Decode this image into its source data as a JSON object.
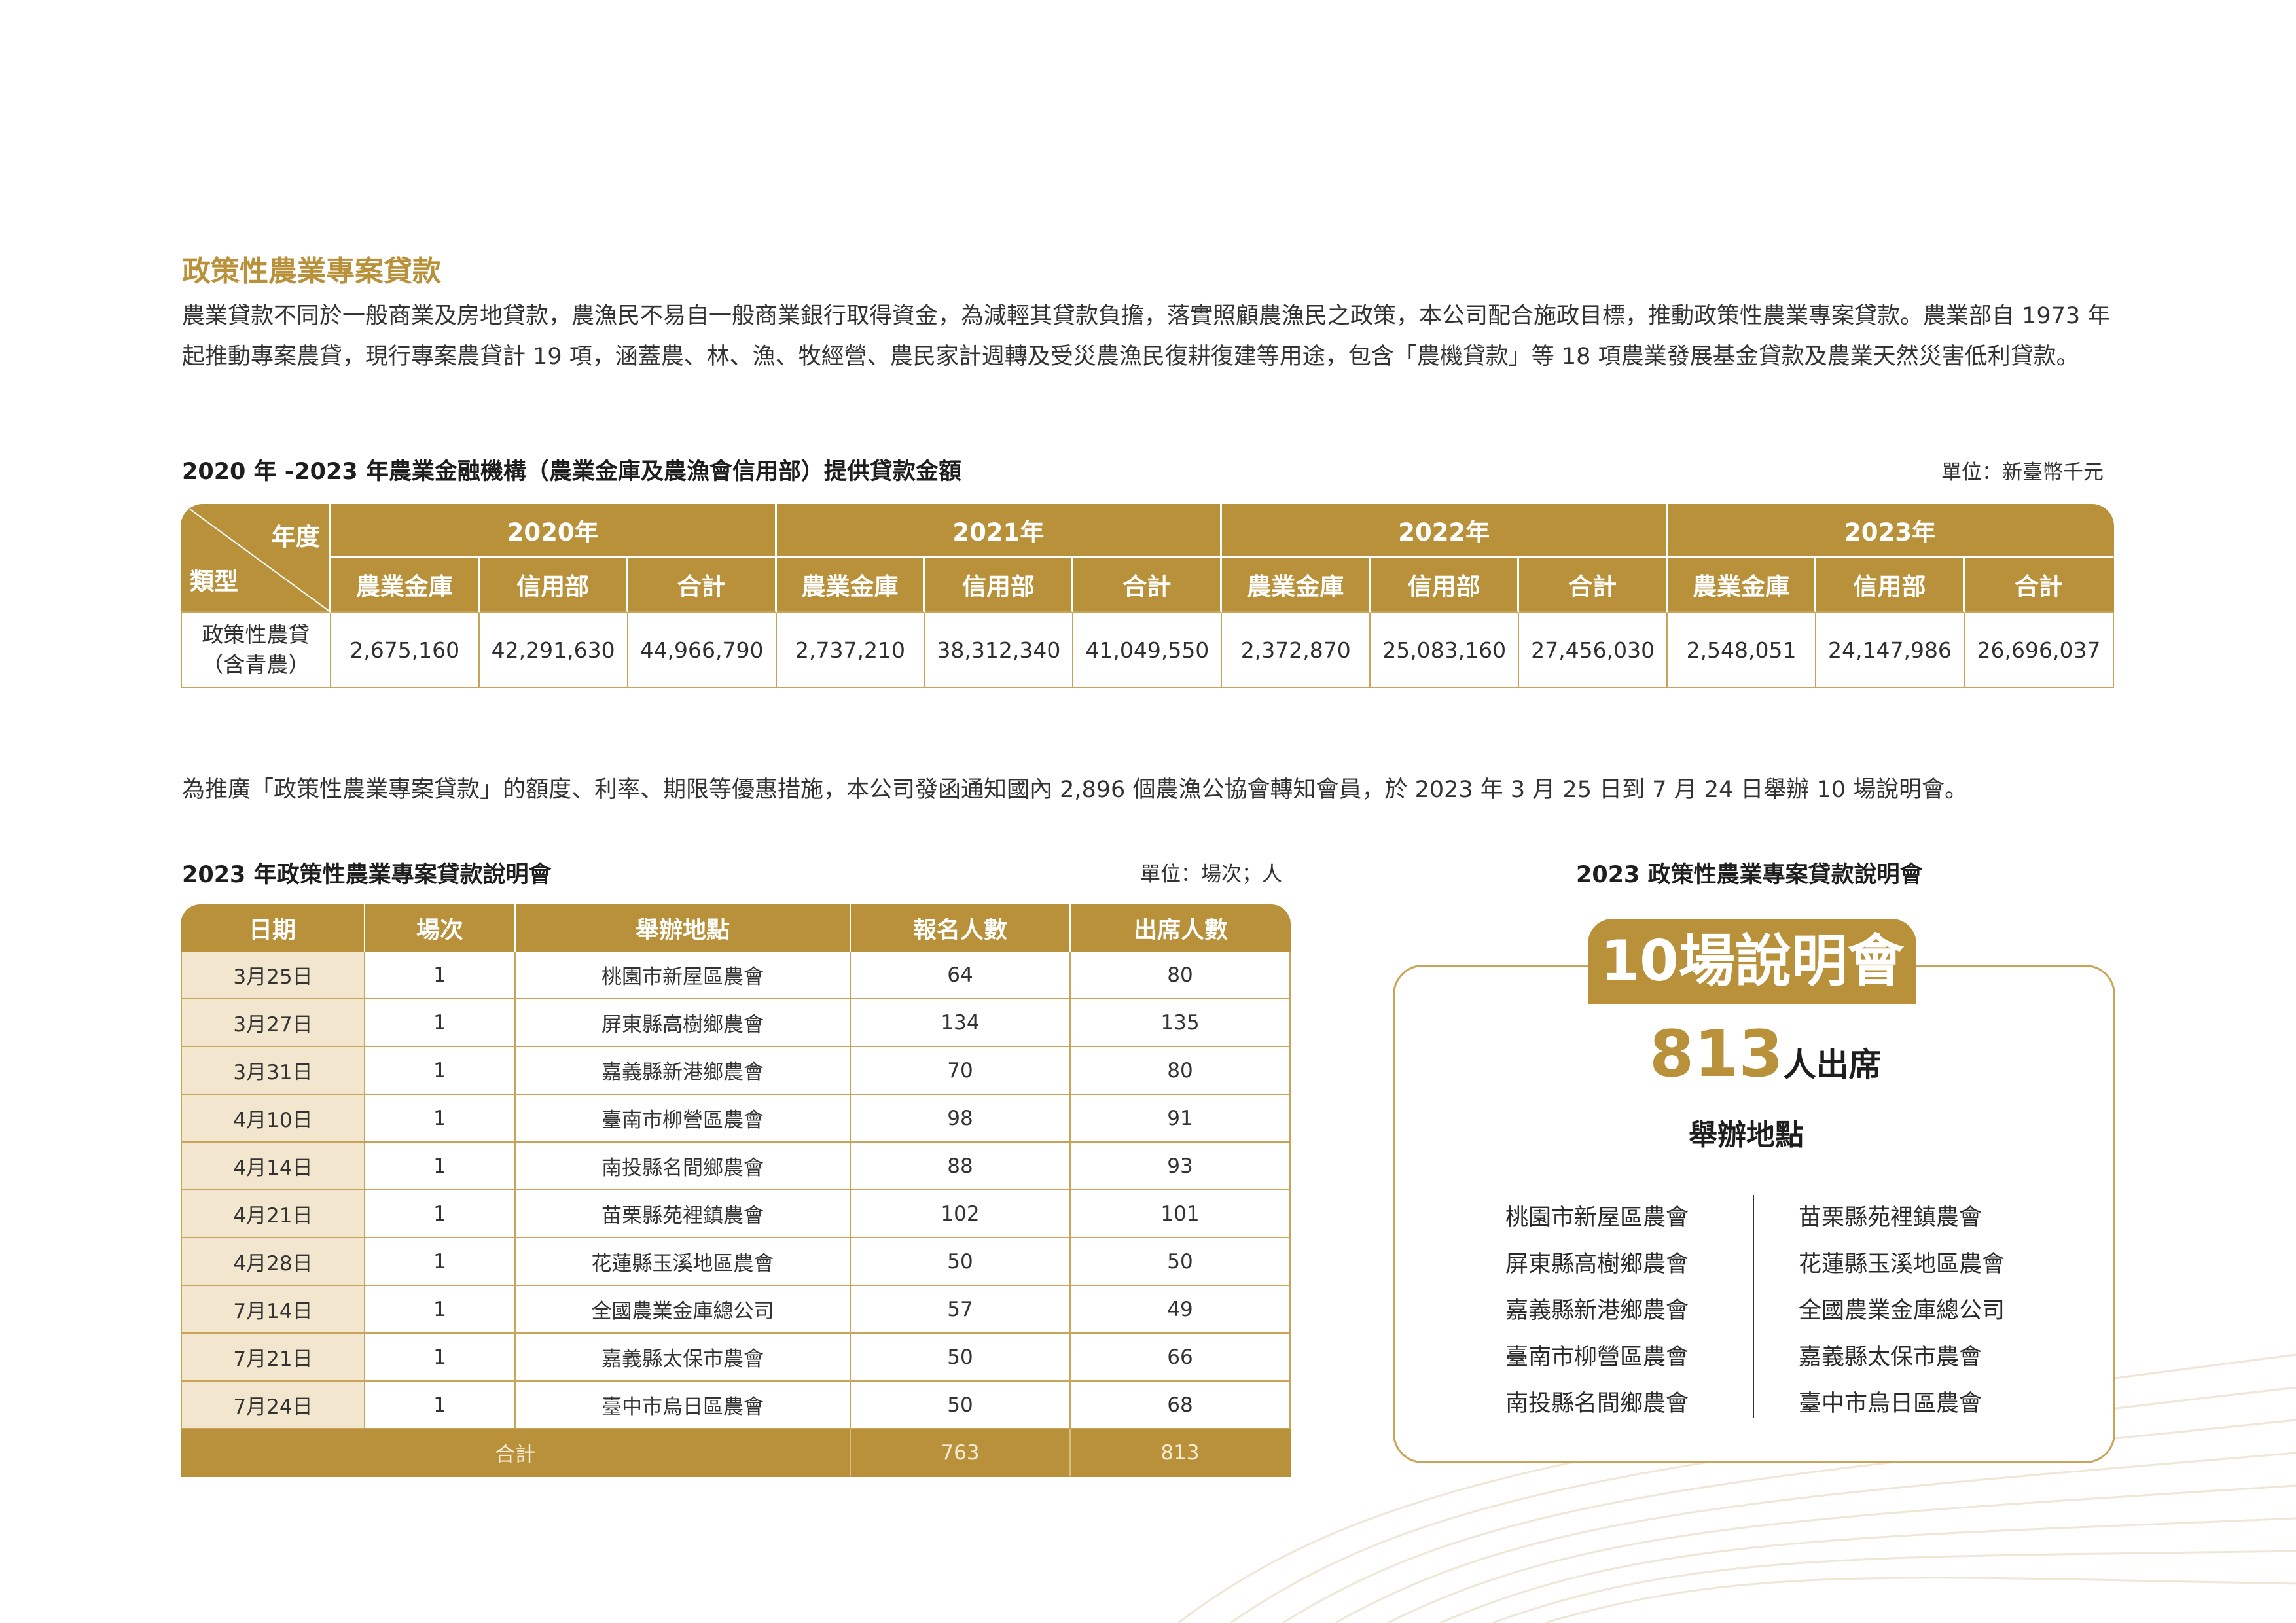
{
  "section_title": "政策性農業專案貸款",
  "intro_paragraph": "農業貸款不同於一般商業及房地貸款，農漁民不易自一般商業銀行取得資金，為減輕其貸款負擔，落實照顧農漁民之政策，本公司配合施政目標，推動政策性農業專案貸款。農業部自 1973 年起推動專案農貸，現行專案農貸計 19 項，涵蓋農、林、漁、牧經營、農民家計週轉及受災農漁民復耕復建等用途，包含「農機貸款」等 18 項農業發展基金貸款及農業天然災害低利貸款。",
  "loan_table": {
    "title": "2020 年 -2023 年農業金融機構（農業金庫及農漁會信用部）提供貸款金額",
    "unit": "單位：新臺幣千元",
    "corner_top": "年度",
    "corner_bottom": "類型",
    "years": [
      "2020年",
      "2021年",
      "2022年",
      "2023年"
    ],
    "sub_headers": [
      "農業金庫",
      "信用部",
      "合計"
    ],
    "row_label_line1": "政策性農貸",
    "row_label_line2": "（含青農）",
    "values": [
      "2,675,160",
      "42,291,630",
      "44,966,790",
      "2,737,210",
      "38,312,340",
      "41,049,550",
      "2,372,870",
      "25,083,160",
      "27,456,030",
      "2,548,051",
      "24,147,986",
      "26,696,037"
    ]
  },
  "promo_paragraph": "為推廣「政策性農業專案貸款」的額度、利率、期限等優惠措施，本公司發函通知國內 2,896 個農漁公協會轉知會員，於 2023 年 3 月 25 日到 7 月 24 日舉辦 10 場說明會。",
  "seminar_table": {
    "title": "2023 年政策性農業專案貸款說明會",
    "unit": "單位：場次；人",
    "headers": [
      "日期",
      "場次",
      "舉辦地點",
      "報名人數",
      "出席人數"
    ],
    "rows": [
      [
        "3月25日",
        "1",
        "桃園市新屋區農會",
        "64",
        "80"
      ],
      [
        "3月27日",
        "1",
        "屏東縣高樹鄉農會",
        "134",
        "135"
      ],
      [
        "3月31日",
        "1",
        "嘉義縣新港鄉農會",
        "70",
        "80"
      ],
      [
        "4月10日",
        "1",
        "臺南市柳營區農會",
        "98",
        "91"
      ],
      [
        "4月14日",
        "1",
        "南投縣名間鄉農會",
        "88",
        "93"
      ],
      [
        "4月21日",
        "1",
        "苗栗縣苑裡鎮農會",
        "102",
        "101"
      ],
      [
        "4月28日",
        "1",
        "花蓮縣玉溪地區農會",
        "50",
        "50"
      ],
      [
        "7月14日",
        "1",
        "全國農業金庫總公司",
        "57",
        "49"
      ],
      [
        "7月21日",
        "1",
        "嘉義縣太保市農會",
        "50",
        "66"
      ],
      [
        "7月24日",
        "1",
        "臺中市烏日區農會",
        "50",
        "68"
      ]
    ],
    "total_label": "合計",
    "total_registered": "763",
    "total_attended": "813"
  },
  "infographic": {
    "title": "2023 政策性農業專案貸款說明會",
    "badge": "10場說明會",
    "attendance_number": "813",
    "attendance_suffix": "人出席",
    "venues_heading": "舉辦地點",
    "venues_left": [
      "桃園市新屋區農會",
      "屏東縣高樹鄉農會",
      "嘉義縣新港鄉農會",
      "臺南市柳營區農會",
      "南投縣名間鄉農會"
    ],
    "venues_right": [
      "苗栗縣苑裡鎮農會",
      "花蓮縣玉溪地區農會",
      "全國農業金庫總公司",
      "嘉義縣太保市農會",
      "臺中市烏日區農會"
    ]
  },
  "colors": {
    "accent": "#b8913a",
    "light_fill": "#f3e6cf",
    "border": "#c8a45a"
  }
}
